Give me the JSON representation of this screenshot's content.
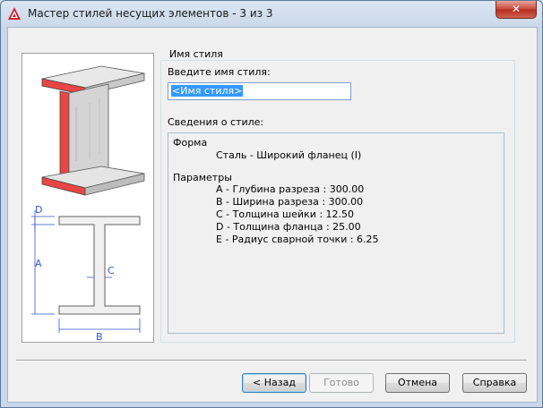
{
  "window": {
    "title": "Мастер стилей несущих элементов - 3 из 3",
    "close_symbol": "✕"
  },
  "group": {
    "label": "Имя стиля"
  },
  "style_name": {
    "prompt_label": "Введите имя стиля:",
    "value": "<Имя стиля>"
  },
  "style_info": {
    "label": "Сведения о стиле:",
    "shape_heading": "Форма",
    "shape_value": "Сталь - Широкий фланец (I)",
    "params_heading": "Параметры",
    "params": [
      "A - Глубина разреза : 300.00",
      "B - Ширина разреза : 300.00",
      "C - Толщина шейки : 12.50",
      "D - Толщина фланца : 25.00",
      "E - Радиус сварной точки : 6.25"
    ]
  },
  "diagram": {
    "label_a": "A",
    "label_b": "B",
    "label_c": "C",
    "label_d": "D"
  },
  "buttons": {
    "back": "< Назад",
    "finish": "Готово",
    "cancel": "Отмена",
    "help": "Справка"
  },
  "colors": {
    "accent_red": "#e8373a",
    "dimension_blue": "#3355cc",
    "selection": "#3399ff"
  }
}
